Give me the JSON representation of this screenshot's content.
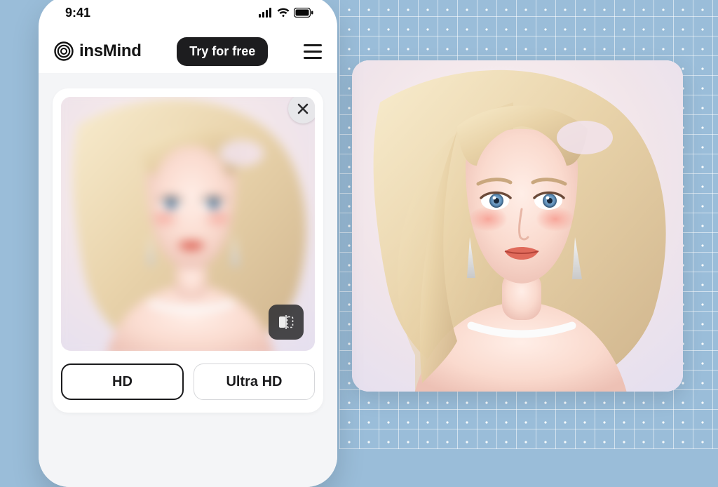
{
  "statusbar": {
    "time": "9:41"
  },
  "app": {
    "brand": "insMind",
    "cta": "Try for free"
  },
  "quality": {
    "hd": "HD",
    "ultra": "Ultra HD"
  }
}
